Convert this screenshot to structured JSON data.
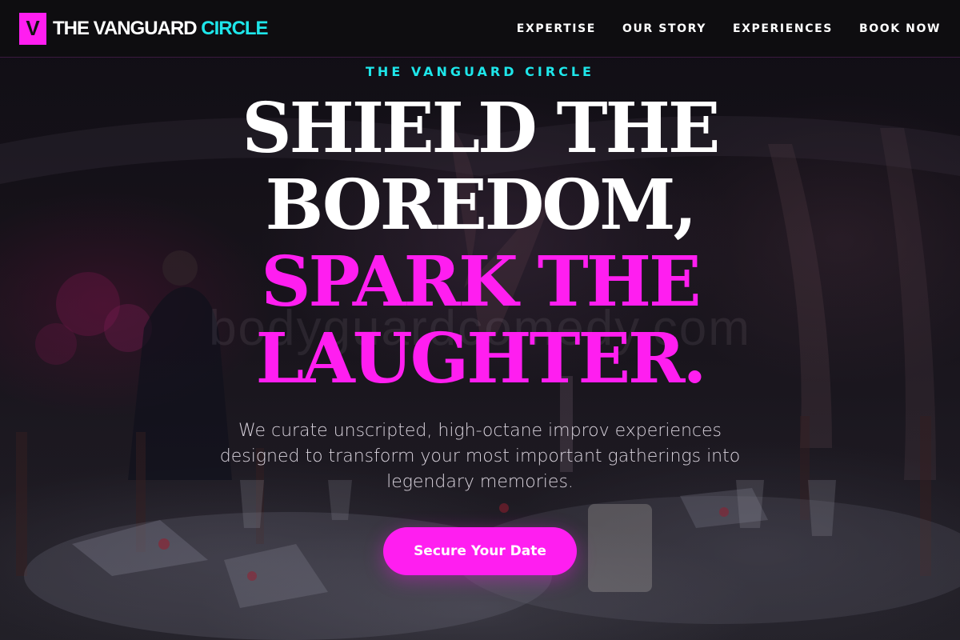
{
  "brand": {
    "mark": "V",
    "name_main": "THE VANGUARD ",
    "name_accent": "CIRCLE"
  },
  "nav": {
    "items": [
      {
        "label": "EXPERTISE"
      },
      {
        "label": "OUR STORY"
      },
      {
        "label": "EXPERIENCES"
      },
      {
        "label": "BOOK NOW"
      }
    ]
  },
  "hero": {
    "eyebrow": "THE VANGUARD CIRCLE",
    "headline_lines": [
      {
        "text": "SHIELD THE"
      },
      {
        "text": "BOREDOM,"
      },
      {
        "text": "SPARK THE"
      },
      {
        "text": "LAUGHTER."
      }
    ],
    "watermark": "bodyguardcomedy.com",
    "subcopy": "We curate unscripted, high-octane improv experiences designed to transform your most important gatherings into legendary memories.",
    "cta_label": "Secure Your Date"
  },
  "colors": {
    "accent_pink": "#ff1ef0",
    "accent_cyan": "#1ee6ea",
    "nav_bg": "#0e0d10"
  }
}
